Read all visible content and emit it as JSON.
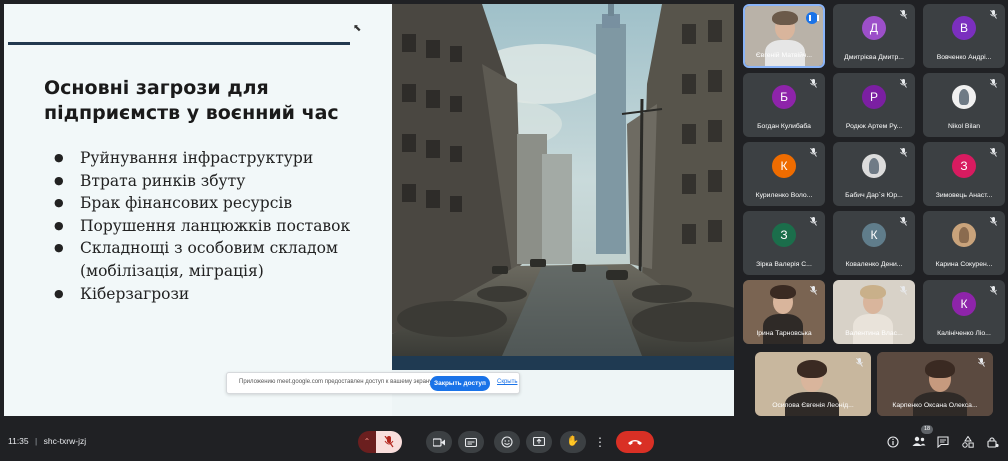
{
  "meeting": {
    "time": "11:35",
    "separator": "|",
    "code": "shc-txrw-jzj",
    "participant_count": "18"
  },
  "slide": {
    "title": "Основні загрози для підприємств у воєнний час",
    "bullets": [
      "Руйнування інфраструктури",
      "Втрата ринків збуту",
      "Брак фінансових ресурсів",
      "Порушення ланцюжків поставок",
      "Складнощі з особовим складом (мобілізація, міграція)",
      "Кіберзагрози"
    ]
  },
  "share_notice": {
    "text": "Приложению meet.google.com предоставлен доступ к вашему экрану.",
    "stop_button": "Закрыть доступ",
    "hide_link": "Скрыть"
  },
  "participants": [
    {
      "name": "Євгеній Матвійч...",
      "initial": "",
      "color": "#8a6d5a"
    },
    {
      "name": "Дмитрієва Дмитр...",
      "initial": "Д",
      "color": "#9c4fc9"
    },
    {
      "name": "Вовченко Андрі...",
      "initial": "В",
      "color": "#7b2fbf"
    },
    {
      "name": "Богдан Кулибаба",
      "initial": "Б",
      "color": "#8e24aa"
    },
    {
      "name": "Родюк Артем Ру...",
      "initial": "Р",
      "color": "#7b1fa2"
    },
    {
      "name": "Nikol Bilan",
      "initial": "",
      "color": "#cfd8dc"
    },
    {
      "name": "Куриленко Воло...",
      "initial": "К",
      "color": "#ef6c00"
    },
    {
      "name": "Бабич Дар`я Юр...",
      "initial": "",
      "color": "#e0e0e0"
    },
    {
      "name": "Зимовець Анаст...",
      "initial": "З",
      "color": "#d81b60"
    },
    {
      "name": "Зірка Валерія С...",
      "initial": "З",
      "color": "#1b6e4b"
    },
    {
      "name": "Коваленко Дени...",
      "initial": "К",
      "color": "#607d8b"
    },
    {
      "name": "Карина Сокурен...",
      "initial": "",
      "color": "#b08d6a"
    },
    {
      "name": "Ірина Тарновська",
      "initial": "",
      "color": "#6d5b4f"
    },
    {
      "name": "Валентина Влас...",
      "initial": "",
      "color": "#c8bfb0"
    },
    {
      "name": "Калініченко Ліо...",
      "initial": "К",
      "color": "#8e24aa"
    },
    {
      "name": "Осипова Євгенія Леонід...",
      "initial": "",
      "color": "#6b5447"
    },
    {
      "name": "Карпенко Оксана Олекса...",
      "initial": "",
      "color": "#4a3d35"
    }
  ],
  "controls": {
    "chevron": "⌃",
    "mic_off": "✕",
    "camera": "▭",
    "captions": "CC",
    "emoji": "☺",
    "present": "⇪",
    "hand": "✋",
    "more": "⋮",
    "end": "☎"
  },
  "colors": {
    "background": "#202124",
    "tile": "#3c4043",
    "accent": "#1a73e8",
    "end_call": "#d93025",
    "slide_rule": "#22394f"
  }
}
